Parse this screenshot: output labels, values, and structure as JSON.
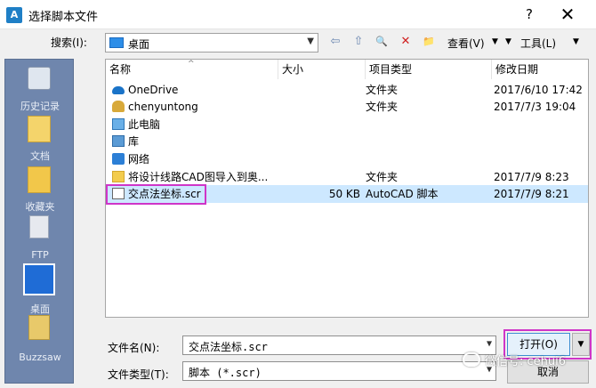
{
  "window": {
    "title": "选择脚本文件",
    "help": "?",
    "close": "✕",
    "app_icon_text": "A"
  },
  "toolbar": {
    "lookin_label": "搜索(I):",
    "lookin_value": "桌面",
    "back_icon": "⇦",
    "up_icon": "⇧",
    "search_icon": "🔍",
    "delete_icon": "✕",
    "newfolder_icon": "📁",
    "views_label": "查看(V)",
    "tools_label": "工具(L)",
    "dropdown_glyph": "▼"
  },
  "places": [
    {
      "label": "历史记录",
      "icon": "history-icon"
    },
    {
      "label": "文档",
      "icon": "documents-icon"
    },
    {
      "label": "收藏夹",
      "icon": "favorites-icon"
    },
    {
      "label": "FTP",
      "icon": "ftp-icon"
    },
    {
      "label": "桌面",
      "icon": "desktop-icon"
    },
    {
      "label": "Buzzsaw",
      "icon": "buzzsaw-icon"
    }
  ],
  "file_list": {
    "columns": [
      "名称",
      "大小",
      "项目类型",
      "修改日期"
    ],
    "sort_glyph": "^",
    "rows": [
      {
        "name": "OneDrive",
        "size": "",
        "type": "文件夹",
        "date": "2017/6/10 17:42",
        "icon": "onedrive-icon"
      },
      {
        "name": "chenyuntong",
        "size": "",
        "type": "文件夹",
        "date": "2017/7/3 19:04",
        "icon": "user-folder-icon"
      },
      {
        "name": "此电脑",
        "size": "",
        "type": "",
        "date": "",
        "icon": "computer-icon"
      },
      {
        "name": "库",
        "size": "",
        "type": "",
        "date": "",
        "icon": "library-icon"
      },
      {
        "name": "网络",
        "size": "",
        "type": "",
        "date": "",
        "icon": "network-icon"
      },
      {
        "name": "将设计线路CAD图导入到奥...",
        "size": "",
        "type": "文件夹",
        "date": "2017/7/9 8:23",
        "icon": "folder-icon"
      },
      {
        "name": "交点法坐标.scr",
        "size": "50 KB",
        "type": "AutoCAD 脚本",
        "date": "2017/7/9 8:21",
        "icon": "script-file-icon",
        "selected": true
      }
    ]
  },
  "bottom": {
    "filename_label": "文件名(N):",
    "filename_value": "交点法坐标.scr",
    "filetype_label": "文件类型(T):",
    "filetype_value": "脚本 (*.scr)",
    "open_label": "打开(O)",
    "cancel_label": "取消",
    "dropdown_glyph": "▼"
  },
  "watermark": "微信号: cehui6",
  "colors": {
    "highlight": "#cf35c8",
    "selection": "#cde8ff",
    "places_bg": "#6f86ad"
  }
}
